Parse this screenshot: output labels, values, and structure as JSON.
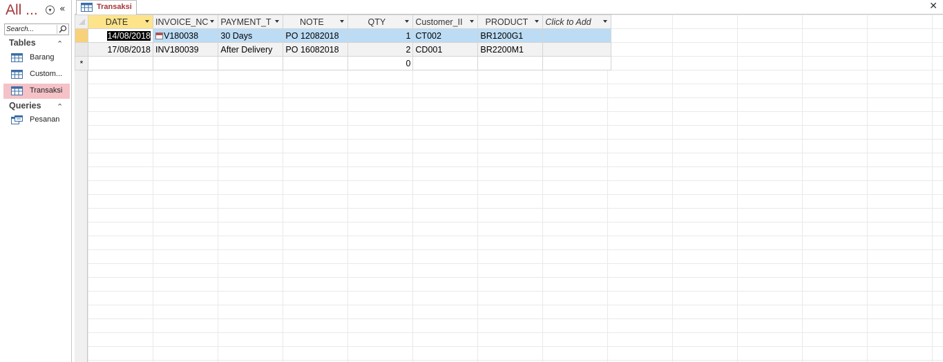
{
  "nav": {
    "title": "All ...",
    "search_placeholder": "Search...",
    "groups": [
      {
        "label": "Tables",
        "items": [
          {
            "label": "Barang",
            "selected": false
          },
          {
            "label": "Custom...",
            "selected": false
          },
          {
            "label": "Transaksi",
            "selected": true
          }
        ]
      },
      {
        "label": "Queries",
        "items": [
          {
            "label": "Pesanan",
            "selected": false
          }
        ]
      }
    ]
  },
  "tab": {
    "label": "Transaksi"
  },
  "sheet": {
    "columns": [
      "DATE",
      "INVOICE_NC",
      "PAYMENT_T",
      "NOTE",
      "QTY",
      "Customer_II",
      "PRODUCT",
      "Click to Add"
    ],
    "rows": [
      {
        "date": "14/08/2018",
        "invoice": "V180038",
        "payment": "30 Days",
        "note": "PO 12082018",
        "qty": "1",
        "customer": "CT002",
        "product": "BR1200G1"
      },
      {
        "date": "17/08/2018",
        "invoice": "INV180039",
        "payment": "After Delivery",
        "note": "PO 16082018",
        "qty": "2",
        "customer": "CD001",
        "product": "BR2200M1"
      }
    ],
    "new_row": {
      "marker": "*",
      "qty": "0"
    }
  },
  "colors": {
    "accent": "#a4373a",
    "selected_row": "#bcdcf5",
    "active_header": "#fde48a",
    "nav_selected": "#f4c2c7"
  }
}
